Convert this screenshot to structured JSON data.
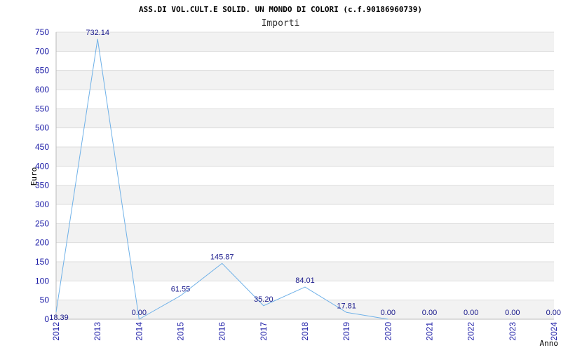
{
  "chart_data": {
    "type": "line",
    "title": "ASS.DI VOL.CULT.E SOLID. UN MONDO DI COLORI (c.f.90186960739)",
    "subtitle": "Importi",
    "xlabel": "Anno",
    "ylabel": "Euro",
    "categories": [
      "2012",
      "2013",
      "2014",
      "2015",
      "2016",
      "2017",
      "2018",
      "2019",
      "2020",
      "2021",
      "2022",
      "2023",
      "2024"
    ],
    "series": [
      {
        "values": [
          18.39,
          732.14,
          0.0,
          61.55,
          145.87,
          35.2,
          84.01,
          17.81,
          0.0,
          null,
          null,
          null,
          null
        ],
        "labels": [
          "18.39",
          "732.14",
          "0.00",
          "61.55",
          "145.87",
          "35.20",
          "84.01",
          "17.81",
          "0.00",
          "0.00",
          "0.00",
          "0.00",
          "0.00"
        ]
      }
    ],
    "ylim": [
      0,
      750
    ],
    "yticks": [
      0,
      50,
      100,
      150,
      200,
      250,
      300,
      350,
      400,
      450,
      500,
      550,
      600,
      650,
      700,
      750
    ],
    "grid": true,
    "colors": {
      "line": "#6fb1e8",
      "band": "#f2f2f2",
      "gridline": "#dddddd",
      "tick_text": "#1a1aa6",
      "label_text": "#1a1a8c"
    }
  }
}
